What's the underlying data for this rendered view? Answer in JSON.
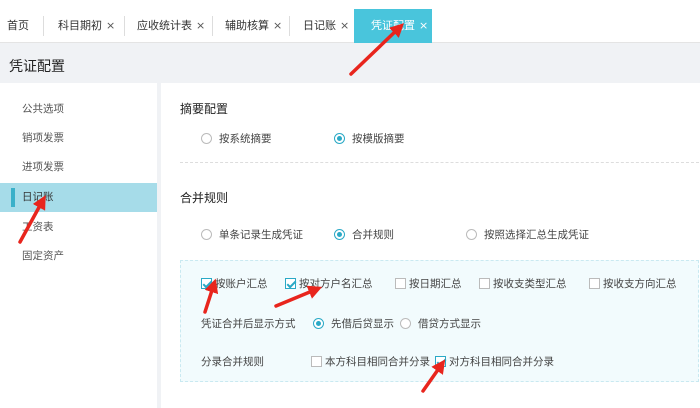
{
  "tabs": [
    {
      "label": "首页",
      "closable": false
    },
    {
      "label": "科目期初",
      "closable": true
    },
    {
      "label": "应收统计表",
      "closable": true
    },
    {
      "label": "辅助核算",
      "closable": true
    },
    {
      "label": "日记账",
      "closable": true
    },
    {
      "label": "凭证配置",
      "closable": true,
      "active": true
    }
  ],
  "close_glyph": "×",
  "page_title": "凭证配置",
  "sidebar": {
    "items": [
      {
        "label": "公共选项"
      },
      {
        "label": "销项发票"
      },
      {
        "label": "进项发票"
      },
      {
        "label": "日记账",
        "active": true
      },
      {
        "label": "工资表"
      },
      {
        "label": "固定资产"
      }
    ]
  },
  "summary_config": {
    "title": "摘要配置",
    "options": [
      {
        "label": "按系统摘要",
        "selected": false
      },
      {
        "label": "按模版摘要",
        "selected": true
      }
    ]
  },
  "merge_rules": {
    "title": "合并规则",
    "options": [
      {
        "label": "单条记录生成凭证",
        "selected": false
      },
      {
        "label": "合并规则",
        "selected": true
      },
      {
        "label": "按照选择汇总生成凭证",
        "selected": false
      }
    ],
    "checkboxes": [
      {
        "label": "按账户汇总",
        "checked": true
      },
      {
        "label": "按对方户名汇总",
        "checked": true
      },
      {
        "label": "按日期汇总",
        "checked": false
      },
      {
        "label": "按收支类型汇总",
        "checked": false
      },
      {
        "label": "按收支方向汇总",
        "checked": false
      }
    ],
    "display_label": "凭证合并后显示方式",
    "display_options": [
      {
        "label": "先借后贷显示",
        "selected": true
      },
      {
        "label": "借贷方式显示",
        "selected": false
      }
    ],
    "entry_label": "分录合并规则",
    "entry_options": [
      {
        "label": "本方科目相同合并分录",
        "checked": false
      },
      {
        "label": "对方科目相同合并分录",
        "checked": true
      }
    ]
  },
  "colors": {
    "accent": "#49c5dc",
    "sidebar_active": "#a6dce9",
    "annotation_red": "#e8251d"
  }
}
